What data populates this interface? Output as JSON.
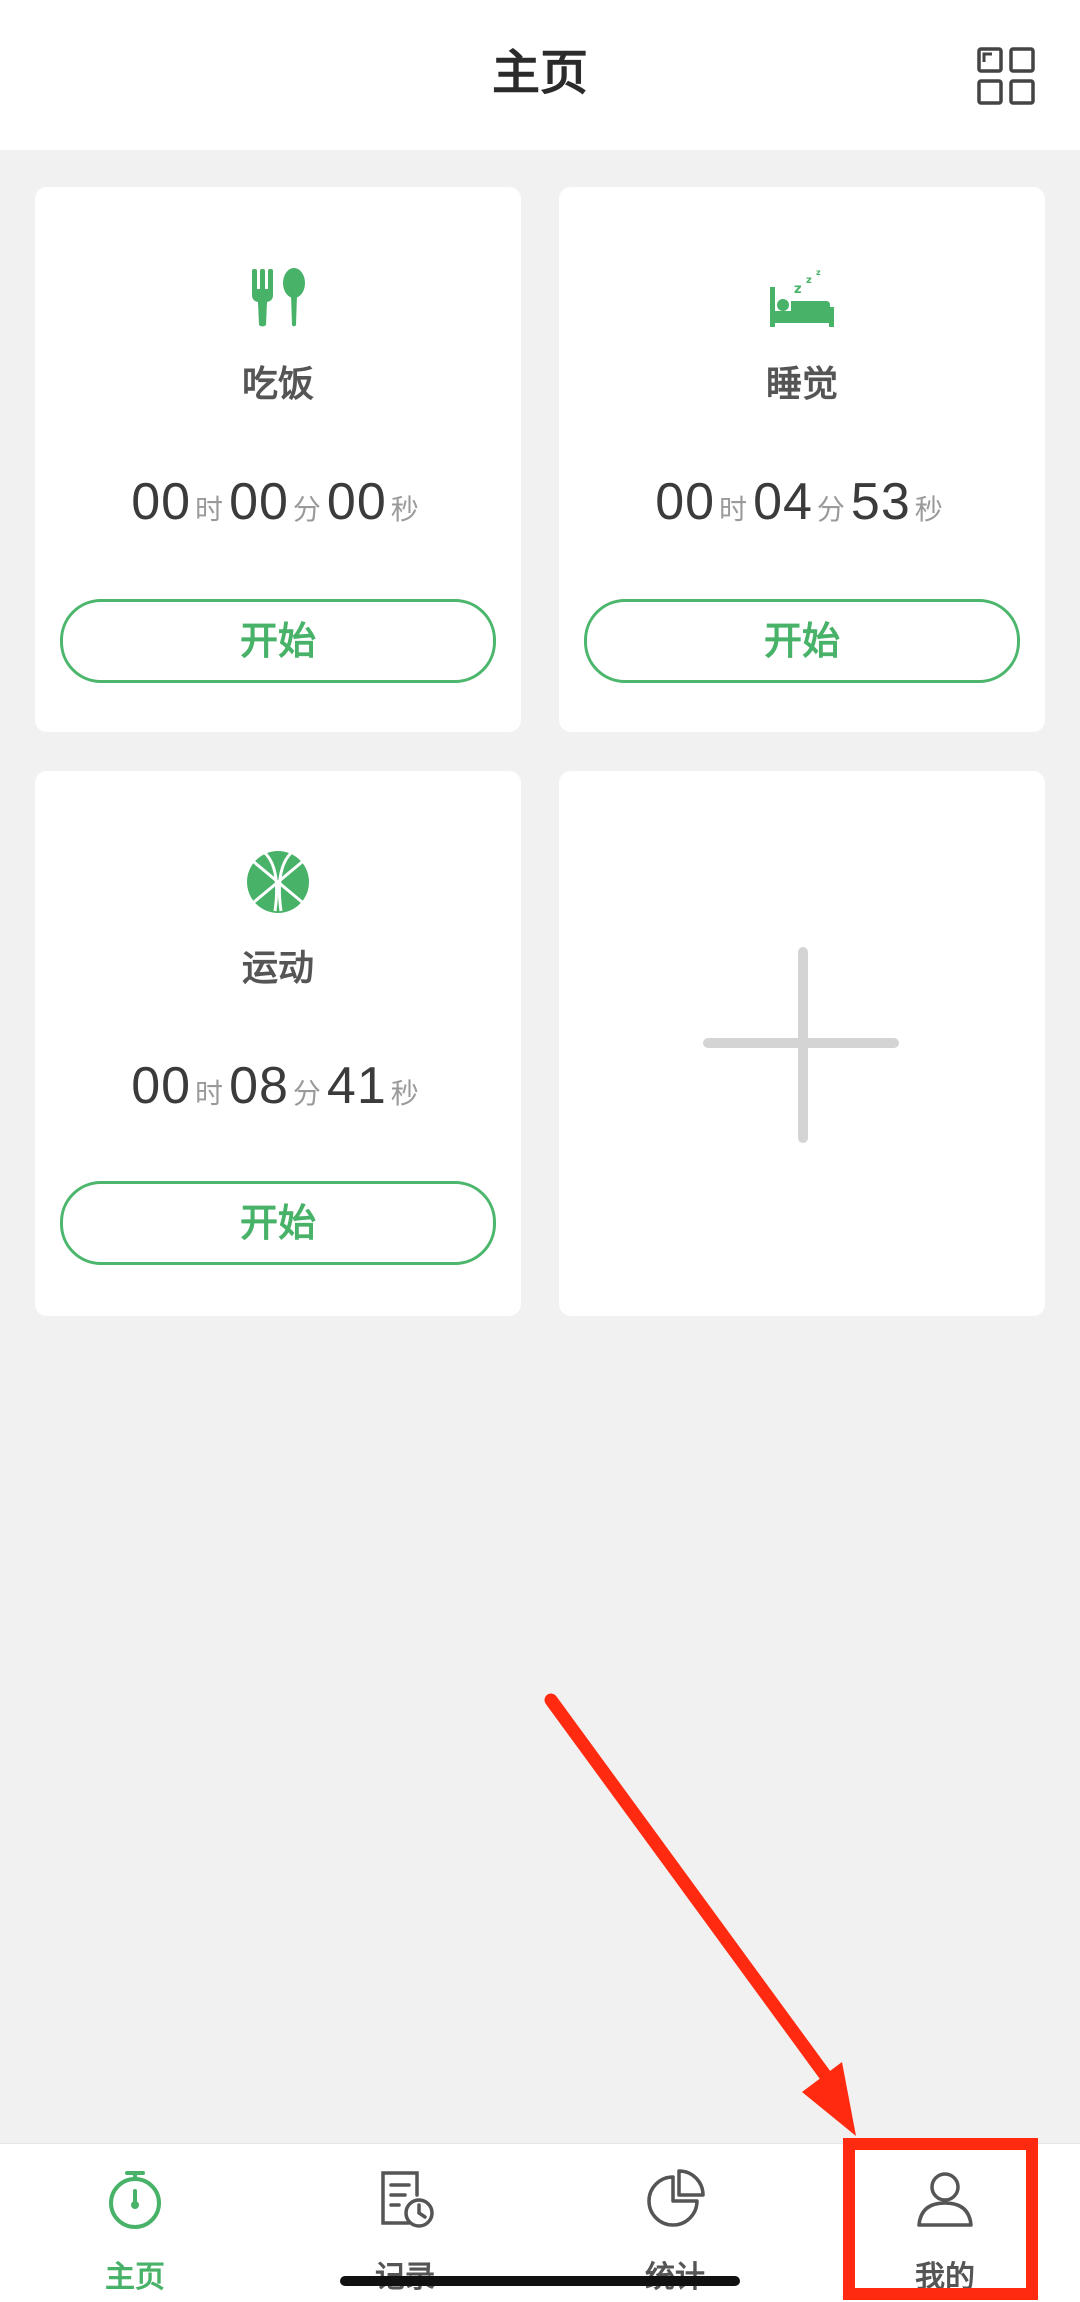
{
  "header": {
    "title": "主页",
    "menu_icon": "grid-icon"
  },
  "cards": [
    {
      "label": "吃饭",
      "icon": "fork-spoon-icon",
      "hours": "00",
      "minutes": "00",
      "seconds": "00",
      "button_label": "开始"
    },
    {
      "label": "睡觉",
      "icon": "sleep-bed-icon",
      "hours": "00",
      "minutes": "04",
      "seconds": "53",
      "button_label": "开始"
    },
    {
      "label": "运动",
      "icon": "basketball-icon",
      "hours": "00",
      "minutes": "08",
      "seconds": "41",
      "button_label": "开始"
    }
  ],
  "add_card": {
    "icon": "plus-icon"
  },
  "units": {
    "hour": "时",
    "minute": "分",
    "second": "秒"
  },
  "tabs": [
    {
      "label": "主页",
      "icon": "stopwatch-icon",
      "active": true
    },
    {
      "label": "记录",
      "icon": "record-icon",
      "active": false
    },
    {
      "label": "统计",
      "icon": "pie-chart-icon",
      "active": false
    },
    {
      "label": "我的",
      "icon": "user-icon",
      "active": false
    }
  ],
  "colors": {
    "accent": "#47b268",
    "background": "#f1f1f1",
    "card": "#ffffff",
    "annotation": "#ff2a10"
  }
}
